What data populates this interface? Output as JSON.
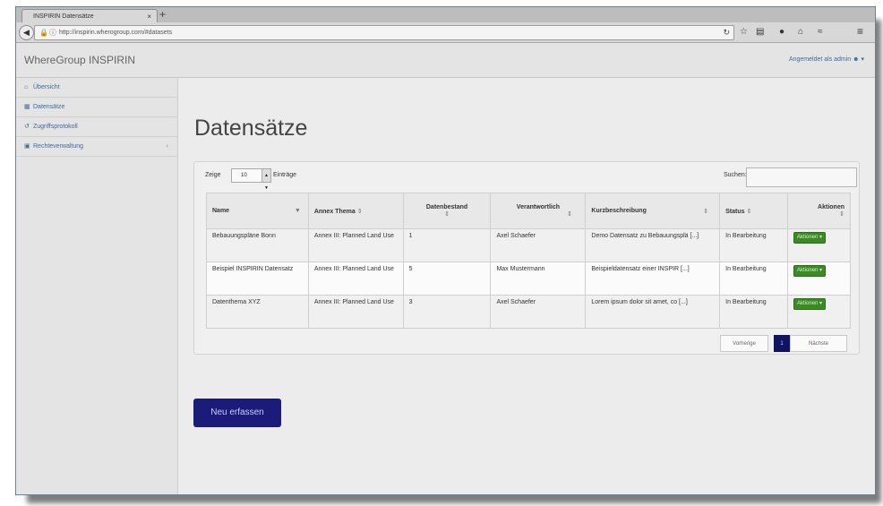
{
  "browser": {
    "tab_title": "INSPIRIN Datensätze",
    "tab_close": "×",
    "new_tab": "+",
    "url": "http://inspirin.wherogroup.com/#datasets",
    "icons": [
      "back-icon",
      "lock-icon",
      "info-icon",
      "reload-icon",
      "star-icon",
      "bookmarks-icon",
      "pocket-icon",
      "home-icon",
      "extensions-icon",
      "menu-icon"
    ]
  },
  "app": {
    "brand": "WhereGroup INSPIRIN",
    "user_menu": "Angemeldet als admin"
  },
  "sidebar": {
    "items": [
      {
        "icon": "home-icon",
        "label": "Übersicht"
      },
      {
        "icon": "database-icon",
        "label": "Datensätze"
      },
      {
        "icon": "history-icon",
        "label": "Zugriffsprotokoll"
      },
      {
        "icon": "users-icon",
        "label": "Rechteverwaltung",
        "chevron": "‹"
      }
    ]
  },
  "main": {
    "title": "Datensätze",
    "length_label": "Zeige",
    "length_value": "10",
    "length_suffix": "Einträge",
    "search_label": "Suchen:",
    "search_value": ""
  },
  "table": {
    "headers": [
      {
        "label": "Name",
        "sort": "▼"
      },
      {
        "label": "Annex Thema",
        "sort": "⇕"
      },
      {
        "label": "Datenbestand",
        "sort": "⇕"
      },
      {
        "label": "Verantwortlich",
        "sort": "⇕"
      },
      {
        "label": "Kurzbeschreibung",
        "sort": "⇕"
      },
      {
        "label": "Status",
        "sort": "⇕"
      },
      {
        "label": "Aktionen",
        "sort": "⇕"
      }
    ],
    "rows": [
      {
        "name": "Bebauungspläne Bonn",
        "annex": "Annex III: Planned Land Use",
        "bestand": "1",
        "verantwortlich": "Axel Schaefer",
        "beschreibung": "Demo Datensatz zu Bebauungsplä [...]",
        "status": "In Bearbeitung",
        "aktion": "Aktionen ▾"
      },
      {
        "name": "Beispiel INSPIRIN Datensatz",
        "annex": "Annex III: Planned Land Use",
        "bestand": "5",
        "verantwortlich": "Max Mustermann",
        "beschreibung": "Beispieldatensatz einer INSPIR [...]",
        "status": "In Bearbeitung",
        "aktion": "Aktionen ▾"
      },
      {
        "name": "Datenthema XYZ",
        "annex": "Annex III: Planned Land Use",
        "bestand": "3",
        "verantwortlich": "Axel Schaefer",
        "beschreibung": "Lorem ipsum dolor sit amet, co [...]",
        "status": "In Bearbeitung",
        "aktion": "Aktionen ▾"
      }
    ]
  },
  "pagination": {
    "prev": "Vorherige",
    "current": "1",
    "next": "Nächste"
  },
  "new_button": "Neu erfassen",
  "colors": {
    "primary": "#1b1b7a",
    "success": "#3a8b24",
    "link": "#3c6b9c"
  }
}
